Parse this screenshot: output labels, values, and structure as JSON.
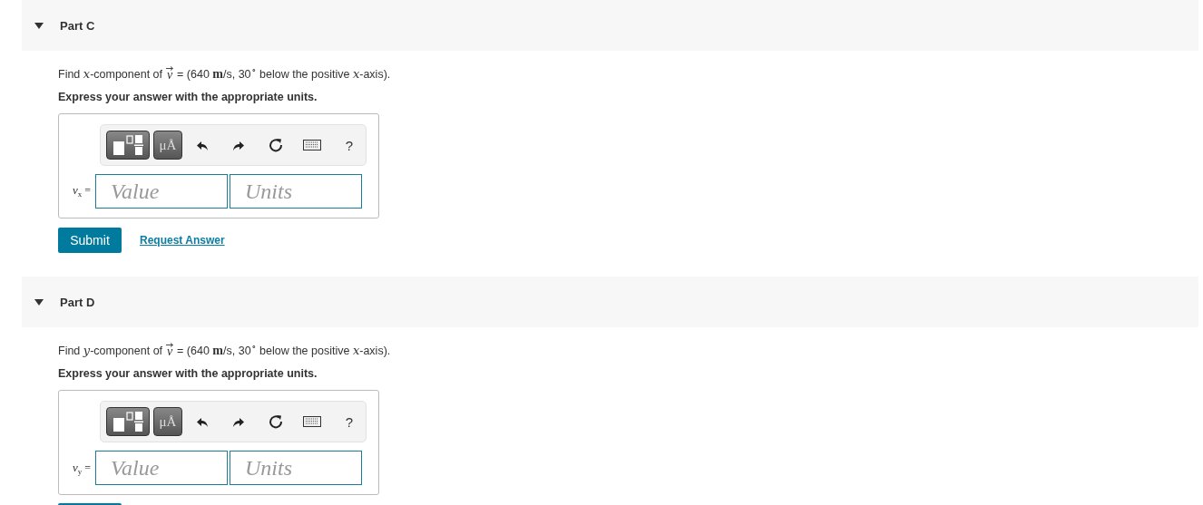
{
  "parts": [
    {
      "title": "Part C",
      "expanded": true,
      "question": {
        "before": "Find *x*-component of",
        "vector": "v",
        "after": "= (640 **m**/s, 30$^{∘}$ below the positive *x*-axis)."
      },
      "instruction": "Express your answer with the appropriate units.",
      "toolbar": {
        "symbol_button": "μÅ",
        "help": "?"
      },
      "answer_label": "*v*$_{x}$ =",
      "value_placeholder": "Value",
      "units_placeholder": "Units",
      "actions": {
        "kind": "full",
        "submit": "Submit",
        "link": "Request Answer"
      }
    },
    {
      "title": "Part D",
      "expanded": true,
      "question": {
        "before": "Find *y*-component of",
        "vector": "v",
        "after": "= (640 **m**/s, 30$^{∘}$ below the positive *x*-axis)."
      },
      "instruction": "Express your answer with the appropriate units.",
      "toolbar": {
        "symbol_button": "μÅ",
        "help": "?"
      },
      "answer_label": "*v*$_{y}$ =",
      "value_placeholder": "Value",
      "units_placeholder": "Units",
      "actions": {
        "kind": "cut"
      }
    }
  ]
}
